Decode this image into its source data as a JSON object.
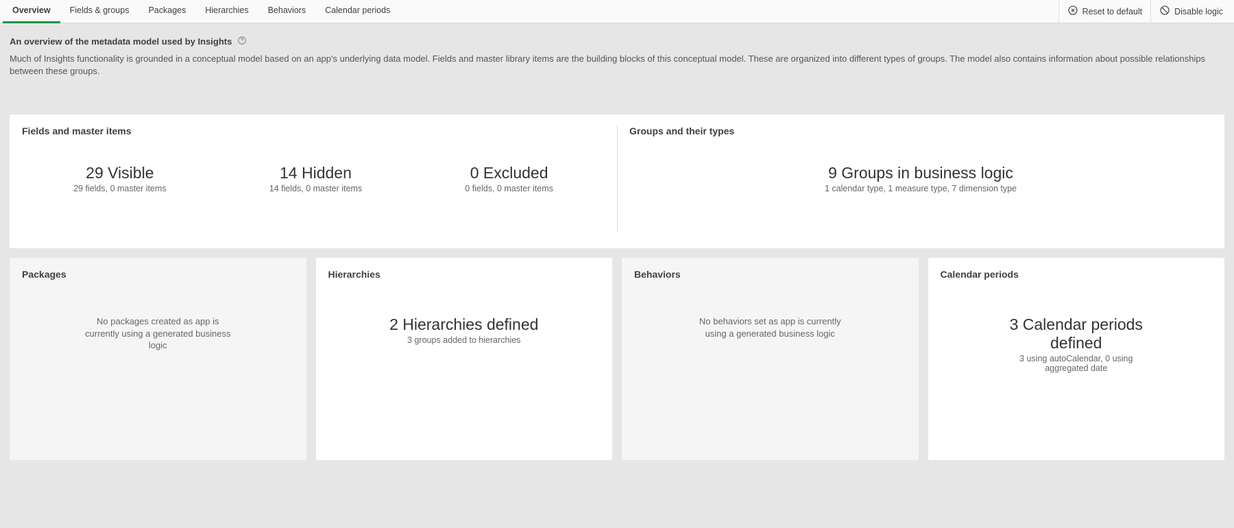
{
  "tabs": {
    "overview": "Overview",
    "fields_groups": "Fields & groups",
    "packages": "Packages",
    "hierarchies": "Hierarchies",
    "behaviors": "Behaviors",
    "calendar_periods": "Calendar periods"
  },
  "actions": {
    "reset": "Reset to default",
    "disable": "Disable logic"
  },
  "description": {
    "title": "An overview of the metadata model used by Insights",
    "text": "Much of Insights functionality is grounded in a conceptual model based on an app's underlying data model. Fields and master library items are the building blocks of this conceptual model. These are organized into different types of groups. The model also contains information about possible relationships between these groups."
  },
  "summary": {
    "fields_master": {
      "title": "Fields and master items",
      "visible": {
        "big": "29 Visible",
        "sub": "29 fields, 0 master items"
      },
      "hidden": {
        "big": "14 Hidden",
        "sub": "14 fields, 0 master items"
      },
      "excluded": {
        "big": "0 Excluded",
        "sub": "0 fields, 0 master items"
      }
    },
    "groups": {
      "title": "Groups and their types",
      "big": "9 Groups in business logic",
      "sub": "1 calendar type, 1 measure type, 7 dimension type"
    }
  },
  "cards": {
    "packages": {
      "title": "Packages",
      "msg": "No packages created as app is currently using a generated business logic"
    },
    "hierarchies": {
      "title": "Hierarchies",
      "big": "2 Hierarchies defined",
      "sub": "3 groups added to hierarchies"
    },
    "behaviors": {
      "title": "Behaviors",
      "msg": "No behaviors set as app is currently using a generated business logic"
    },
    "calendar": {
      "title": "Calendar periods",
      "big": "3 Calendar periods defined",
      "sub": "3 using autoCalendar, 0 using aggregated date"
    }
  }
}
